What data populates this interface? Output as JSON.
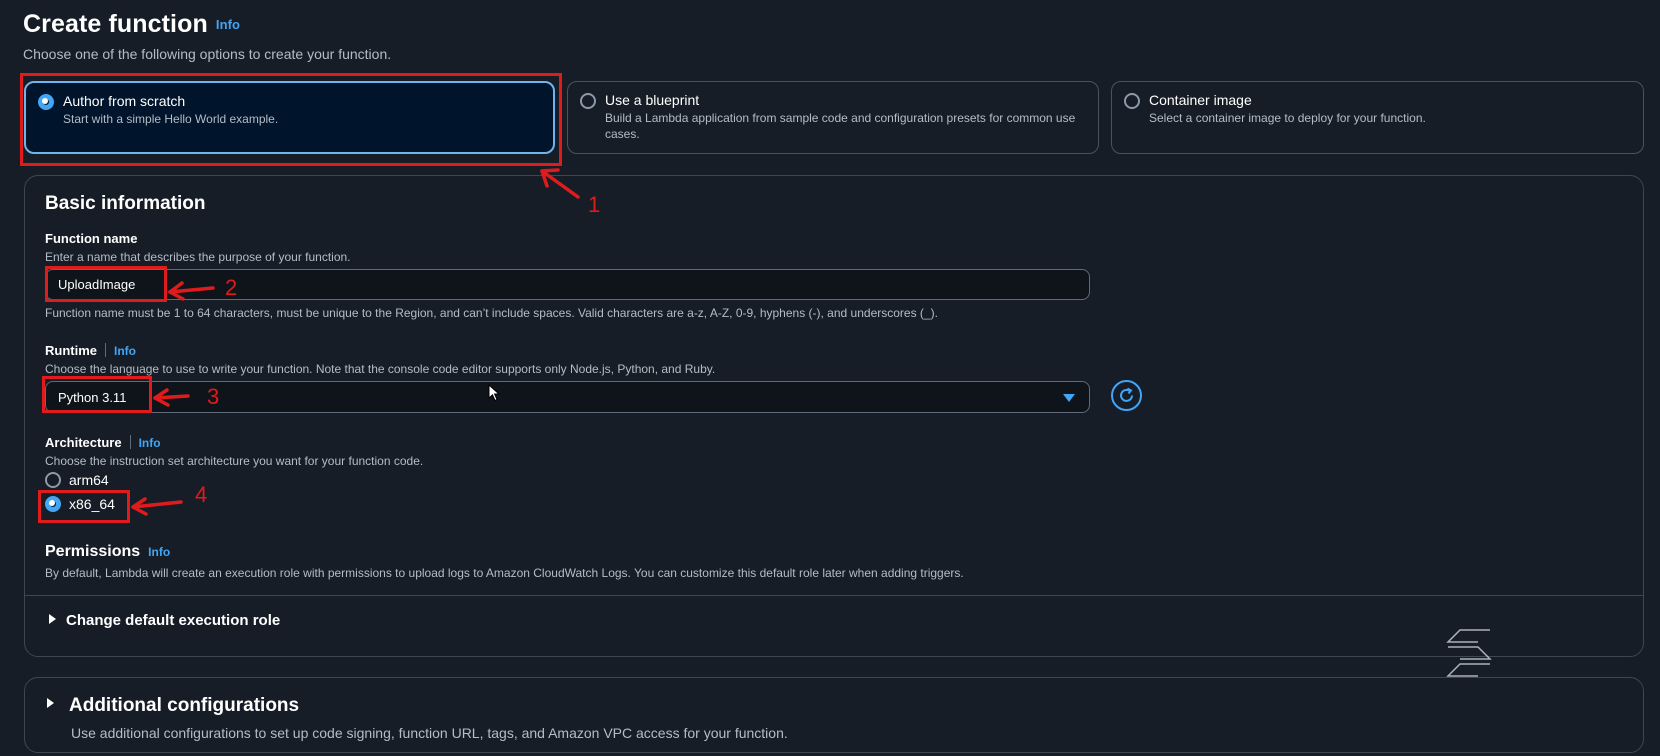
{
  "header": {
    "title": "Create function",
    "info_label": "Info",
    "description": "Choose one of the following options to create your function."
  },
  "options": [
    {
      "title": "Author from scratch",
      "description": "Start with a simple Hello World example.",
      "selected": true
    },
    {
      "title": "Use a blueprint",
      "description": "Build a Lambda application from sample code and configuration presets for common use cases.",
      "selected": false
    },
    {
      "title": "Container image",
      "description": "Select a container image to deploy for your function.",
      "selected": false
    }
  ],
  "basic": {
    "title": "Basic information",
    "function_name": {
      "label": "Function name",
      "description": "Enter a name that describes the purpose of your function.",
      "value": "UploadImage",
      "constraint": "Function name must be 1 to 64 characters, must be unique to the Region, and can’t include spaces. Valid characters are a-z, A-Z, 0-9, hyphens (-), and underscores (_)."
    },
    "runtime": {
      "label": "Runtime",
      "info": "Info",
      "description": "Choose the language to use to write your function. Note that the console code editor supports only Node.js, Python, and Ruby.",
      "value": "Python 3.11"
    },
    "architecture": {
      "label": "Architecture",
      "info": "Info",
      "description": "Choose the instruction set architecture you want for your function code.",
      "options": [
        {
          "label": "arm64",
          "selected": false
        },
        {
          "label": "x86_64",
          "selected": true
        }
      ]
    },
    "permissions": {
      "label": "Permissions",
      "info": "Info",
      "description": "By default, Lambda will create an execution role with permissions to upload logs to Amazon CloudWatch Logs. You can customize this default role later when adding triggers."
    },
    "change_role_label": "Change default execution role"
  },
  "additional": {
    "title": "Additional configurations",
    "description": "Use additional configurations to set up code signing, function URL, tags, and Amazon VPC access for your function."
  },
  "annotations": {
    "numbers": [
      "1",
      "2",
      "3",
      "4"
    ],
    "color": "#e01b1b"
  },
  "colors": {
    "background": "#161d26",
    "accent": "#42a5f5",
    "selected_tile_bg": "#00142b"
  }
}
